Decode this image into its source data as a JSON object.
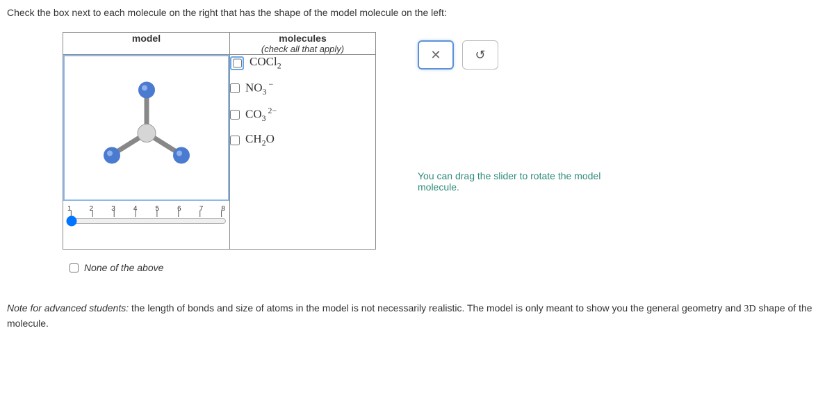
{
  "question": "Check the box next to each molecule on the right that has the shape of the model molecule on the left:",
  "headers": {
    "model": "model",
    "molecules": "molecules",
    "molecules_sub": "(check all that apply)"
  },
  "slider": {
    "ticks": [
      "1",
      "2",
      "3",
      "4",
      "5",
      "6",
      "7",
      "8"
    ],
    "value": 1,
    "min": 1,
    "max": 8
  },
  "molecules": [
    {
      "html": "COCl<sub>2</sub>",
      "highlighted": true
    },
    {
      "html": "NO<sub>3</sub><sup>&nbsp;−</sup>",
      "highlighted": false
    },
    {
      "html": "CO<sub>3</sub><sup>&nbsp;2−</sup>",
      "highlighted": false
    },
    {
      "html": "CH<sub>2</sub>O",
      "highlighted": false
    }
  ],
  "buttons": {
    "close": "✕",
    "reset": "↺"
  },
  "hint": "You can drag the slider to rotate the model molecule.",
  "none_label": "None of the above",
  "note_label": "Note for advanced students:",
  "note_body": " the length of bonds and size of atoms in the model is not necessarily realistic. The model is only meant to show you the general geometry and ",
  "note_3d": "3D",
  "note_tail": " shape of the molecule."
}
